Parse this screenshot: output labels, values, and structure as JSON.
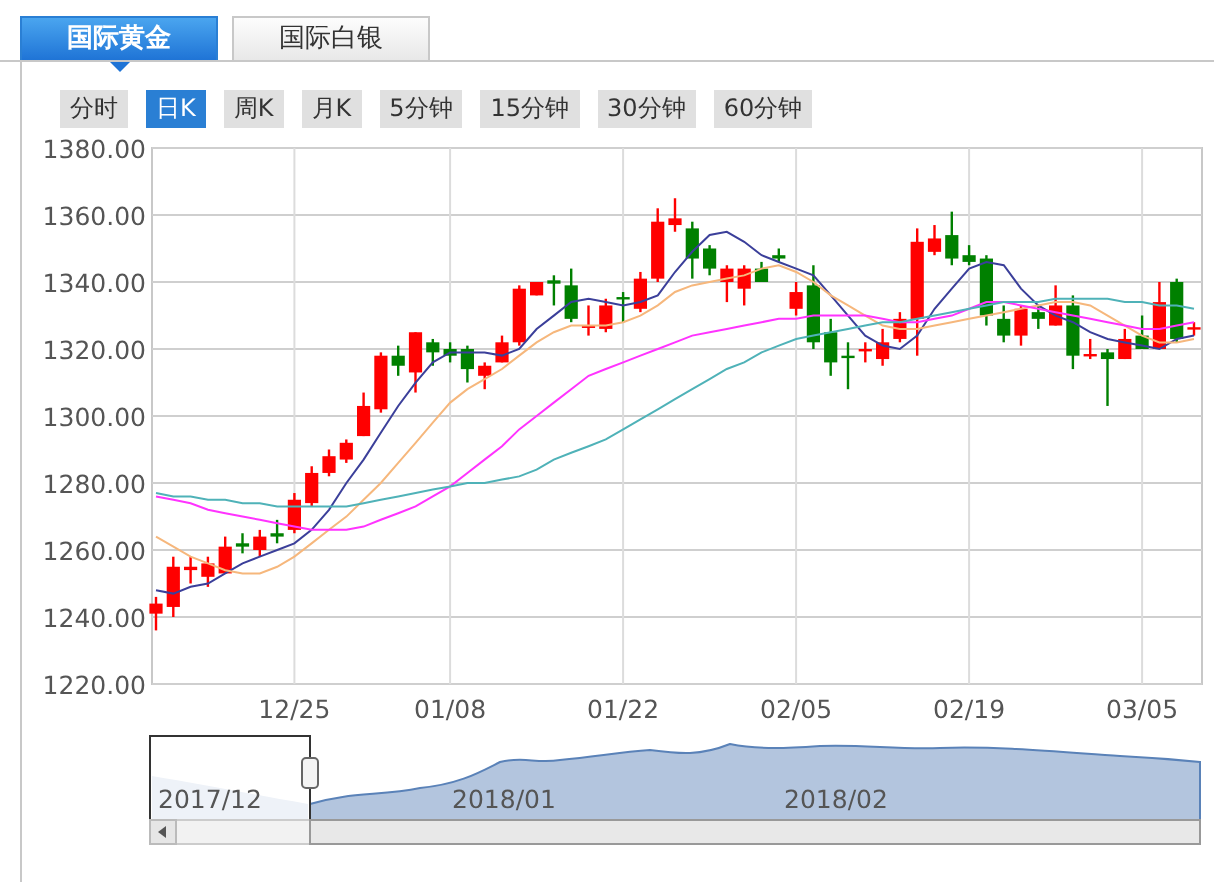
{
  "tabs": [
    {
      "label": "国际黄金",
      "selected": true
    },
    {
      "label": "国际白银",
      "selected": false
    }
  ],
  "periods": [
    {
      "label": "分时",
      "selected": false
    },
    {
      "label": "日K",
      "selected": true
    },
    {
      "label": "周K",
      "selected": false
    },
    {
      "label": "月K",
      "selected": false
    },
    {
      "label": "5分钟",
      "selected": false
    },
    {
      "label": "15分钟",
      "selected": false
    },
    {
      "label": "30分钟",
      "selected": false
    },
    {
      "label": "60分钟",
      "selected": false
    }
  ],
  "chart": {
    "chart_data": {
      "type": "candlestick",
      "grid": true,
      "ylim": [
        1220,
        1380
      ],
      "categories": [
        null,
        null,
        null,
        null,
        null,
        null,
        null,
        null,
        "12/25",
        null,
        null,
        null,
        null,
        null,
        null,
        null,
        null,
        "01/08",
        null,
        null,
        null,
        null,
        null,
        null,
        null,
        null,
        null,
        "01/22",
        null,
        null,
        null,
        null,
        null,
        null,
        null,
        null,
        null,
        "02/05",
        null,
        null,
        null,
        null,
        null,
        null,
        null,
        null,
        null,
        "02/19",
        null,
        null,
        null,
        null,
        null,
        null,
        null,
        null,
        null,
        "03/05",
        null,
        null,
        null
      ],
      "yticks": [
        {
          "value": 1220,
          "label": "1220.00"
        },
        {
          "value": 1240,
          "label": "1240.00"
        },
        {
          "value": 1260,
          "label": "1260.00"
        },
        {
          "value": 1280,
          "label": "1280.00"
        },
        {
          "value": 1300,
          "label": "1300.00"
        },
        {
          "value": 1320,
          "label": "1320.00"
        },
        {
          "value": 1340,
          "label": "1340.00"
        },
        {
          "value": 1360,
          "label": "1360.00"
        },
        {
          "value": 1380,
          "label": "1380.00"
        }
      ],
      "ohlc": [
        [
          1241,
          1246,
          1236,
          1244
        ],
        [
          1243,
          1258,
          1240,
          1255
        ],
        [
          1254,
          1258,
          1250,
          1255
        ],
        [
          1252,
          1258,
          1249,
          1256
        ],
        [
          1253,
          1264,
          1253,
          1261
        ],
        [
          1262,
          1265,
          1259,
          1261
        ],
        [
          1260,
          1266,
          1258,
          1264
        ],
        [
          1265,
          1269,
          1262,
          1264
        ],
        [
          1266,
          1277,
          1265,
          1275
        ],
        [
          1274,
          1285,
          1273,
          1283
        ],
        [
          1283,
          1290,
          1282,
          1288
        ],
        [
          1287,
          1293,
          1286,
          1292
        ],
        [
          1294,
          1307,
          1294,
          1303
        ],
        [
          1302,
          1319,
          1301,
          1318
        ],
        [
          1318,
          1321,
          1312,
          1315
        ],
        [
          1313,
          1325,
          1307,
          1325
        ],
        [
          1322,
          1323,
          1315,
          1319
        ],
        [
          1320,
          1322,
          1316,
          1318
        ],
        [
          1320,
          1321,
          1310,
          1314
        ],
        [
          1312,
          1316,
          1308,
          1315
        ],
        [
          1316,
          1324,
          1316,
          1322
        ],
        [
          1322,
          1339,
          1321,
          1338
        ],
        [
          1336,
          1340,
          1336,
          1340
        ],
        [
          1340.5,
          1342,
          1333,
          1339.5
        ],
        [
          1339,
          1344,
          1328,
          1329
        ],
        [
          1327,
          1333,
          1324,
          1327
        ],
        [
          1326,
          1335,
          1325,
          1333
        ],
        [
          1335.5,
          1337,
          1328,
          1335
        ],
        [
          1332,
          1343,
          1331,
          1341
        ],
        [
          1341,
          1362,
          1340,
          1358
        ],
        [
          1357,
          1365,
          1355,
          1359
        ],
        [
          1356,
          1358,
          1341,
          1347
        ],
        [
          1350,
          1351,
          1342,
          1344
        ],
        [
          1340,
          1345,
          1334,
          1344
        ],
        [
          1338,
          1345,
          1333,
          1344
        ],
        [
          1344,
          1346,
          1340,
          1340
        ],
        [
          1348,
          1350,
          1346,
          1347
        ],
        [
          1332,
          1340,
          1330,
          1337
        ],
        [
          1339,
          1345,
          1320,
          1322
        ],
        [
          1325,
          1329,
          1312,
          1316
        ],
        [
          1318,
          1322,
          1308,
          1317.5
        ],
        [
          1320,
          1322,
          1316,
          1320
        ],
        [
          1317,
          1326,
          1315,
          1322
        ],
        [
          1323,
          1331,
          1322,
          1329
        ],
        [
          1329,
          1356,
          1318,
          1352
        ],
        [
          1349,
          1357,
          1348,
          1353
        ],
        [
          1354,
          1361,
          1345,
          1347
        ],
        [
          1348,
          1351,
          1345,
          1346
        ],
        [
          1347,
          1348,
          1327,
          1330
        ],
        [
          1329,
          1333,
          1322,
          1324
        ],
        [
          1324,
          1333,
          1321,
          1332
        ],
        [
          1331,
          1333,
          1326,
          1329
        ],
        [
          1327,
          1339,
          1327,
          1333
        ],
        [
          1333,
          1336,
          1314,
          1318
        ],
        [
          1318,
          1323,
          1317,
          1318.5
        ],
        [
          1319,
          1320,
          1303,
          1317
        ],
        [
          1317,
          1326,
          1317,
          1323
        ],
        [
          1324,
          1330,
          1320,
          1320
        ],
        [
          1320,
          1340,
          1320,
          1334
        ],
        [
          1340,
          1341,
          1322,
          1323
        ],
        [
          1326,
          1328,
          1324,
          1326.5
        ]
      ],
      "series": [
        {
          "type": "line",
          "color": "#3b3f9a",
          "values": [
            1248,
            1247,
            1249,
            1250,
            1253,
            1256,
            1258,
            1260,
            1262,
            1266,
            1272,
            1280,
            1287,
            1295,
            1303,
            1310,
            1316,
            1319,
            1319,
            1319,
            1318,
            1320,
            1326,
            1330,
            1334,
            1335,
            1334,
            1333,
            1334,
            1336,
            1343,
            1349,
            1354,
            1355,
            1352,
            1348,
            1346,
            1344,
            1342,
            1336,
            1330,
            1324,
            1321,
            1320,
            1324,
            1332,
            1338,
            1344,
            1346,
            1345,
            1338,
            1333,
            1330,
            1328,
            1325,
            1323,
            1322,
            1321,
            1320,
            1323,
            1324
          ]
        },
        {
          "type": "line",
          "color": "#f6b77c",
          "values": [
            1264,
            1261,
            1258,
            1256,
            1254,
            1253,
            1253,
            1255,
            1258,
            1262,
            1266,
            1270,
            1275,
            1280,
            1286,
            1292,
            1298,
            1304,
            1308,
            1311,
            1314,
            1318,
            1322,
            1325,
            1327,
            1327,
            1327,
            1328,
            1330,
            1333,
            1337,
            1339,
            1340,
            1341,
            1342,
            1344,
            1345,
            1343,
            1340,
            1336,
            1333,
            1330,
            1327,
            1326,
            1326,
            1327,
            1328,
            1329,
            1330,
            1331,
            1332,
            1333,
            1334,
            1334,
            1333,
            1330,
            1327,
            1324,
            1322,
            1322,
            1323
          ]
        },
        {
          "type": "line",
          "color": "#ff33ff",
          "values": [
            1276,
            1275,
            1274,
            1272,
            1271,
            1270,
            1269,
            1268,
            1267,
            1266,
            1266,
            1266,
            1267,
            1269,
            1271,
            1273,
            1276,
            1279,
            1283,
            1287,
            1291,
            1296,
            1300,
            1304,
            1308,
            1312,
            1314,
            1316,
            1318,
            1320,
            1322,
            1324,
            1325,
            1326,
            1327,
            1328,
            1329,
            1329,
            1330,
            1330,
            1330,
            1330,
            1329,
            1328,
            1328,
            1329,
            1330,
            1332,
            1334,
            1334,
            1333,
            1332,
            1331,
            1330,
            1329,
            1328,
            1327,
            1326,
            1326,
            1327,
            1328
          ]
        },
        {
          "type": "line",
          "color": "#4fb2b8",
          "values": [
            1277,
            1276,
            1276,
            1275,
            1275,
            1274,
            1274,
            1273,
            1273,
            1273,
            1273,
            1273,
            1274,
            1275,
            1276,
            1277,
            1278,
            1279,
            1280,
            1280,
            1281,
            1282,
            1284,
            1287,
            1289,
            1291,
            1293,
            1296,
            1299,
            1302,
            1305,
            1308,
            1311,
            1314,
            1316,
            1319,
            1321,
            1323,
            1324,
            1325,
            1326,
            1327,
            1328,
            1328,
            1329,
            1330,
            1331,
            1332,
            1333,
            1334,
            1334,
            1334,
            1335,
            1335,
            1335,
            1335,
            1334,
            1334,
            1333,
            1333,
            1332
          ]
        }
      ]
    }
  },
  "navigator": {
    "labels": [
      "2017/12",
      "2018/01",
      "2018/02"
    ]
  }
}
